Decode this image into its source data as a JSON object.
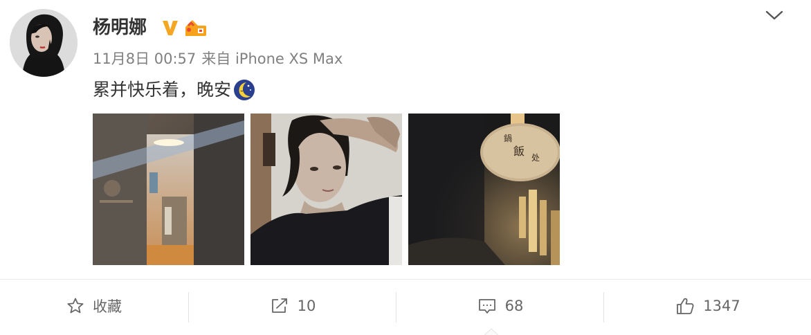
{
  "post": {
    "author": {
      "name": "杨明娜",
      "avatar_icon": "avatar-portrait",
      "verified_icon": "verified-v-icon",
      "level_icon": "member-level-icon"
    },
    "meta": {
      "time": "11月8日 00:57",
      "source": "来自 iPhone XS Max"
    },
    "text": "累并快乐着，晚安",
    "emoji_icon": "moon-sleep-emoji",
    "images": [
      {
        "name": "photo-room-doorway"
      },
      {
        "name": "photo-selfie"
      },
      {
        "name": "photo-dark-sign"
      }
    ]
  },
  "actions": {
    "favorite": {
      "label": "收藏",
      "icon": "star-icon"
    },
    "share": {
      "count": "10",
      "icon": "share-icon"
    },
    "comment": {
      "count": "68",
      "icon": "comment-icon"
    },
    "like": {
      "count": "1347",
      "icon": "thumbs-up-icon"
    }
  },
  "colors": {
    "text_primary": "#333333",
    "text_secondary": "#808080",
    "verified": "#f5a623",
    "divider": "#e6e6e6"
  }
}
